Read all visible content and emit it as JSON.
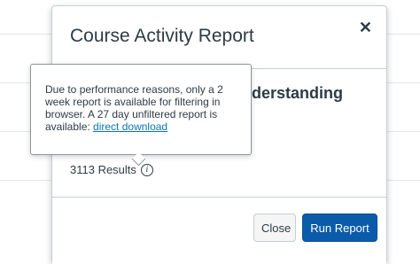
{
  "modal": {
    "title": "Course Activity Report",
    "close_icon": "close-icon",
    "section_heading_visible": "derstanding",
    "results": "3113 Results",
    "info_icon": "info-icon",
    "info_glyph": "i",
    "footer": {
      "close_label": "Close",
      "run_label": "Run Report"
    }
  },
  "tooltip": {
    "text": "Due to performance reasons, only a 2 week report is available for filtering in browser. A 27 day unfiltered report is available: ",
    "link_label": "direct download"
  },
  "colors": {
    "primary_button": "#0b5bab",
    "link": "#0b74b5",
    "text": "#2d3b45"
  }
}
